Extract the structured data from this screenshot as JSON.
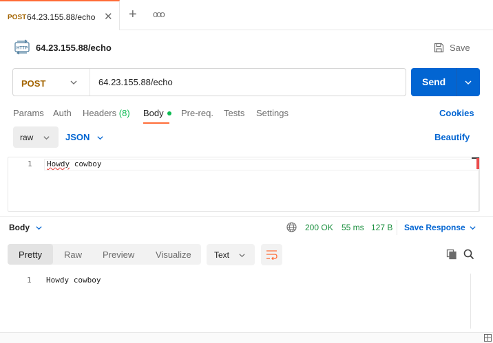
{
  "tab": {
    "method": "POST",
    "title": "64.23.155.88/echo",
    "close_icon": "close-icon",
    "add_icon": "plus-icon",
    "more_label": "ooo"
  },
  "request": {
    "type_icon": "http-icon",
    "title": "64.23.155.88/echo",
    "save_label": "Save",
    "method": "POST",
    "url": "64.23.155.88/echo",
    "send_label": "Send"
  },
  "request_tabs": {
    "params": "Params",
    "auth": "Auth",
    "headers": "Headers",
    "headers_count": "(8)",
    "body": "Body",
    "prereq": "Pre-req.",
    "tests": "Tests",
    "settings": "Settings",
    "cookies": "Cookies"
  },
  "body_mode": {
    "mode": "raw",
    "language": "JSON",
    "beautify": "Beautify"
  },
  "editor": {
    "line_number": "1",
    "line_word_1": "Howdy",
    "line_word_2": " cowboy"
  },
  "response": {
    "label": "Body",
    "status": "200 OK",
    "time": "55 ms",
    "size": "127 B",
    "save_label": "Save Response",
    "views": [
      "Pretty",
      "Raw",
      "Preview",
      "Visualize"
    ],
    "active_view": "Pretty",
    "format": "Text",
    "line_number": "1",
    "body_text": "Howdy cowboy"
  },
  "colors": {
    "accent_orange": "#ff6c37",
    "post_method": "#a36400",
    "primary_blue": "#0265d2",
    "success_green": "#1a8f3e"
  }
}
